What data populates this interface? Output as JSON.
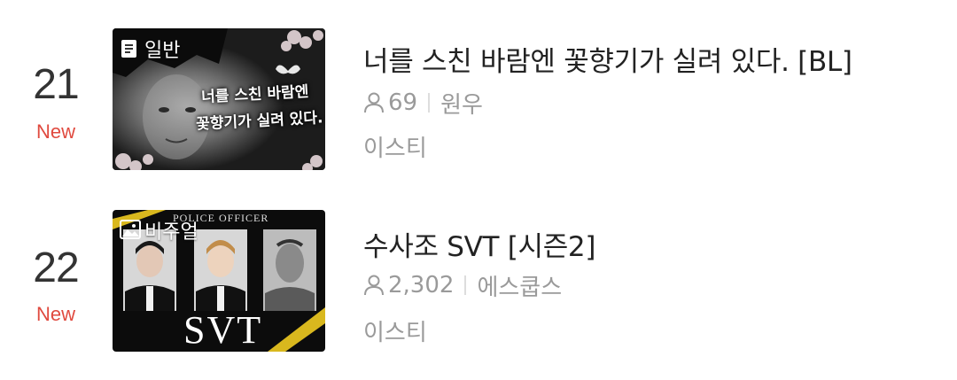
{
  "rows": [
    {
      "rank": "21",
      "status": "New",
      "genre": "일반",
      "genre_icon": "document-icon",
      "title": "너를 스친 바람엔 꽃향기가 실려 있다. [BL]",
      "views": "69",
      "tag": "원우",
      "author": "이스티",
      "thumb_text_line1": "너를 스친 바람엔",
      "thumb_text_line2": "꽃향기가 실려 있다."
    },
    {
      "rank": "22",
      "status": "New",
      "genre": "비주얼",
      "genre_icon": "image-icon",
      "title": "수사조 SVT [시즌2]",
      "views": "2,302",
      "tag": "에스쿱스",
      "author": "이스티",
      "thumb_label": "POLICE OFFICER",
      "thumb_logo": "SVT"
    }
  ],
  "colors": {
    "rank": "#333333",
    "status_new": "#e04a3f",
    "title": "#222222",
    "meta": "#9a9a9a"
  }
}
